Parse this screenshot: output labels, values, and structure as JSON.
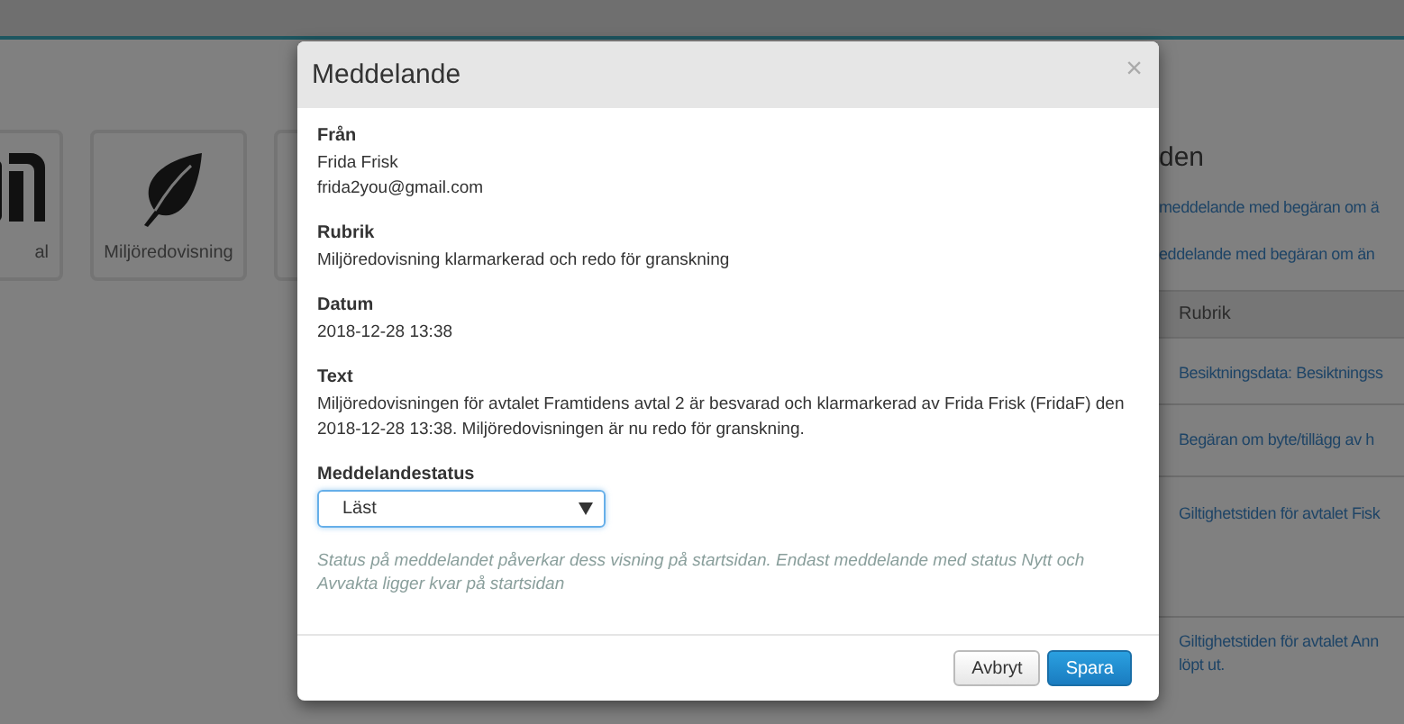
{
  "page": {
    "tiles": [
      {
        "label": "al"
      },
      {
        "label": "Miljöredovisning"
      }
    ],
    "heading": "den",
    "links": [
      "meddelande med begäran om ä",
      "eddelande med begäran om än"
    ],
    "table": {
      "columns": [
        "Rubrik"
      ],
      "rows": [
        "Besiktningsdata: Besiktningss",
        "Begäran om byte/tillägg av h",
        "Giltighetstiden för avtalet Fisk",
        "Giltighetstiden för avtalet Ann\nlöpt ut."
      ]
    }
  },
  "dialog": {
    "title": "Meddelande",
    "close": "×",
    "fields": [
      {
        "label": "Från",
        "lines": [
          "Frida Frisk",
          "frida2you@gmail.com"
        ]
      },
      {
        "label": "Rubrik",
        "lines": [
          "Miljöredovisning klarmarkerad och redo för granskning"
        ]
      },
      {
        "label": "Datum",
        "lines": [
          "2018-12-28 13:38"
        ]
      },
      {
        "label": "Text",
        "lines": [
          "Miljöredovisningen för avtalet Framtidens avtal 2 är besvarad och klarmarkerad av Frida Frisk (FridaF) den 2018-12-28 13:38. Miljöredovisningen är nu redo för granskning."
        ]
      }
    ],
    "status": {
      "label": "Meddelandestatus",
      "value": "Läst",
      "focused": true
    },
    "hint": "Status på meddelandet påverkar dess visning på startsidan. Endast meddelande med status Nytt och Avvakta ligger kvar på startsidan",
    "buttons": [
      {
        "label": "Avbryt",
        "kind": "secondary"
      },
      {
        "label": "Spara",
        "kind": "primary"
      }
    ]
  }
}
